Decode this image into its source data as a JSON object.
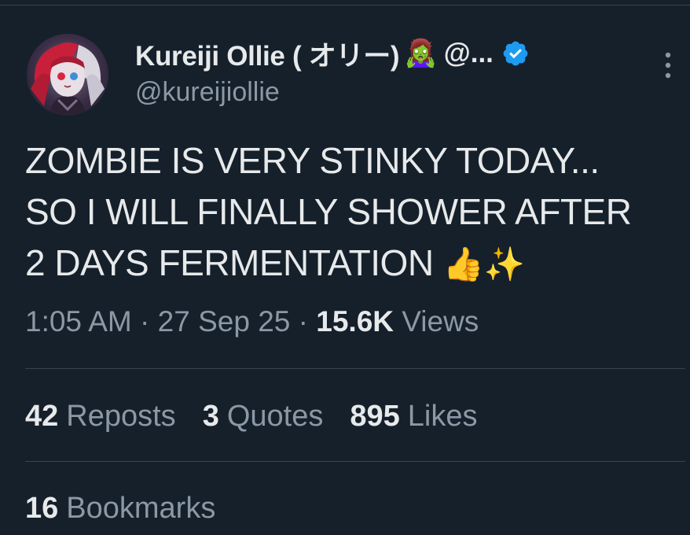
{
  "author": {
    "display_name": "Kureiji Ollie ( オリー)",
    "name_emoji": "🧟‍♀️",
    "name_overflow": "@...",
    "handle": "@kureijiollie",
    "verified": true,
    "verified_color": "#1d9bf0"
  },
  "tweet": {
    "lines": [
      "ZOMBIE IS VERY STINKY TODAY...",
      "SO I WILL FINALLY SHOWER AFTER",
      "2 DAYS FERMENTATION"
    ],
    "trailing_emoji": "👍✨"
  },
  "meta": {
    "time": "1:05 AM",
    "separator": "·",
    "date": "27 Sep 25",
    "views_count": "15.6K",
    "views_label": "Views"
  },
  "stats": {
    "reposts_count": "42",
    "reposts_label": "Reposts",
    "quotes_count": "3",
    "quotes_label": "Quotes",
    "likes_count": "895",
    "likes_label": "Likes",
    "bookmarks_count": "16",
    "bookmarks_label": "Bookmarks"
  },
  "icons": {
    "verified": "verified-badge-icon",
    "more": "more-options-icon"
  },
  "colors": {
    "background": "#15202b",
    "text_primary": "#e7e9ea",
    "text_secondary": "#8b98a5",
    "divider": "#38444d"
  }
}
